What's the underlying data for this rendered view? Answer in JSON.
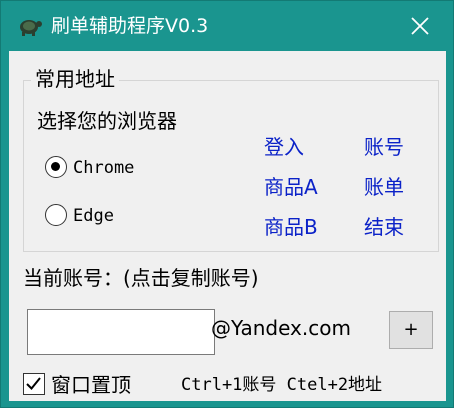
{
  "window": {
    "title": "刷单辅助程序V0.3",
    "close_glyph": "✕"
  },
  "group": {
    "label": "常用地址",
    "browser_prompt": "选择您的浏览器",
    "radios": [
      {
        "label": "Chrome",
        "checked": true
      },
      {
        "label": "Edge",
        "checked": false
      }
    ],
    "links": {
      "login": "登入",
      "account": "账号",
      "product_a": "商品A",
      "bill": "账单",
      "product_b": "商品B",
      "end": "结束"
    }
  },
  "account": {
    "label": "当前账号：(点击复制账号)",
    "value": "",
    "domain": "@Yandex.com",
    "plus_label": "+"
  },
  "footer": {
    "topmost_label": "窗口置顶",
    "topmost_checked": true,
    "shortcuts": "Ctrl+1账号 Ctel+2地址"
  },
  "colors": {
    "titlebar": "#1a958f",
    "link": "#0b22c8"
  }
}
